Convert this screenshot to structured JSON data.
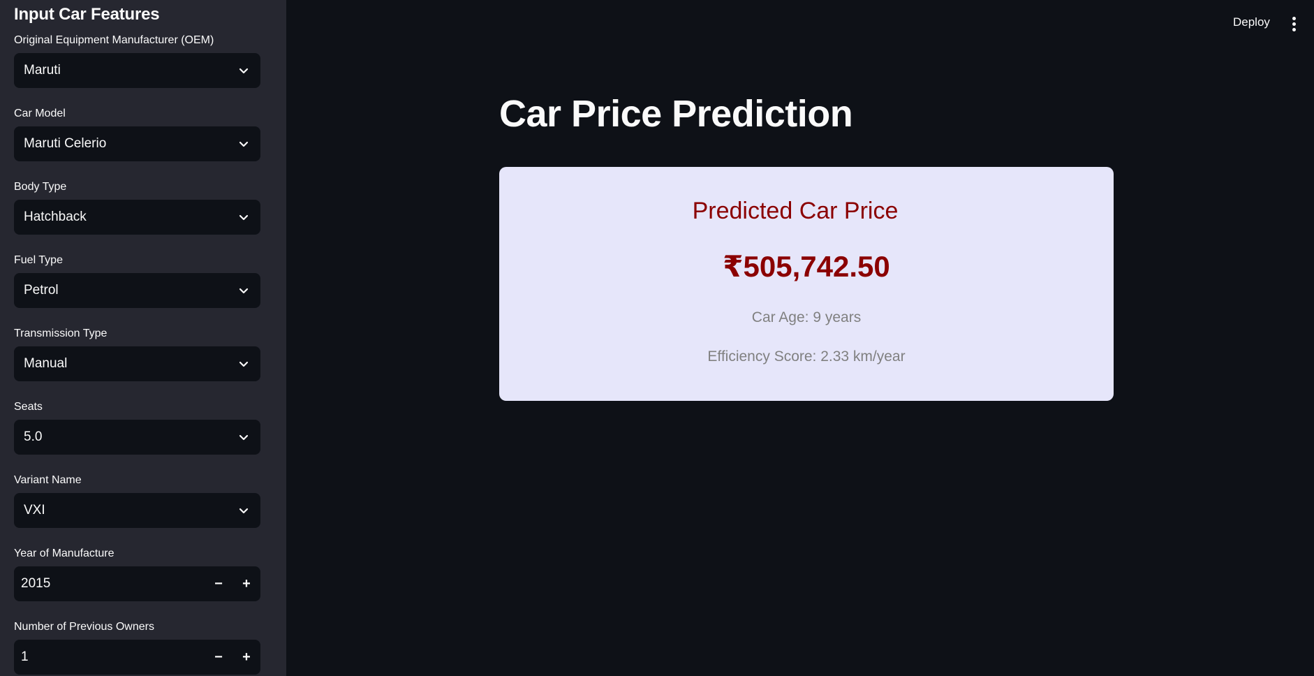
{
  "sidebar": {
    "title": "Input Car Features",
    "fields": [
      {
        "label": "Original Equipment Manufacturer (OEM)",
        "value": "Maruti"
      },
      {
        "label": "Car Model",
        "value": "Maruti Celerio"
      },
      {
        "label": "Body Type",
        "value": "Hatchback"
      },
      {
        "label": "Fuel Type",
        "value": "Petrol"
      },
      {
        "label": "Transmission Type",
        "value": "Manual"
      },
      {
        "label": "Seats",
        "value": "5.0"
      },
      {
        "label": "Variant Name",
        "value": "VXI"
      }
    ],
    "year": {
      "label": "Year of Manufacture",
      "value": "2015",
      "minus": "−",
      "plus": "+"
    },
    "owners": {
      "label": "Number of Previous Owners",
      "value": "1",
      "minus": "−",
      "plus": "+"
    }
  },
  "topbar": {
    "deploy_label": "Deploy",
    "menu_icon": "more-vertical-icon"
  },
  "main": {
    "title": "Car Price Prediction",
    "card": {
      "heading": "Predicted Car Price",
      "price": "₹505,742.50",
      "age": "Car Age: 9 years",
      "efficiency": "Efficiency Score: 2.33 km/year"
    }
  },
  "colors": {
    "background": "#0e1117",
    "sidebar": "#262730",
    "card_background": "#e6e6fa",
    "accent_text": "#8b0000",
    "muted_text": "#808080"
  }
}
